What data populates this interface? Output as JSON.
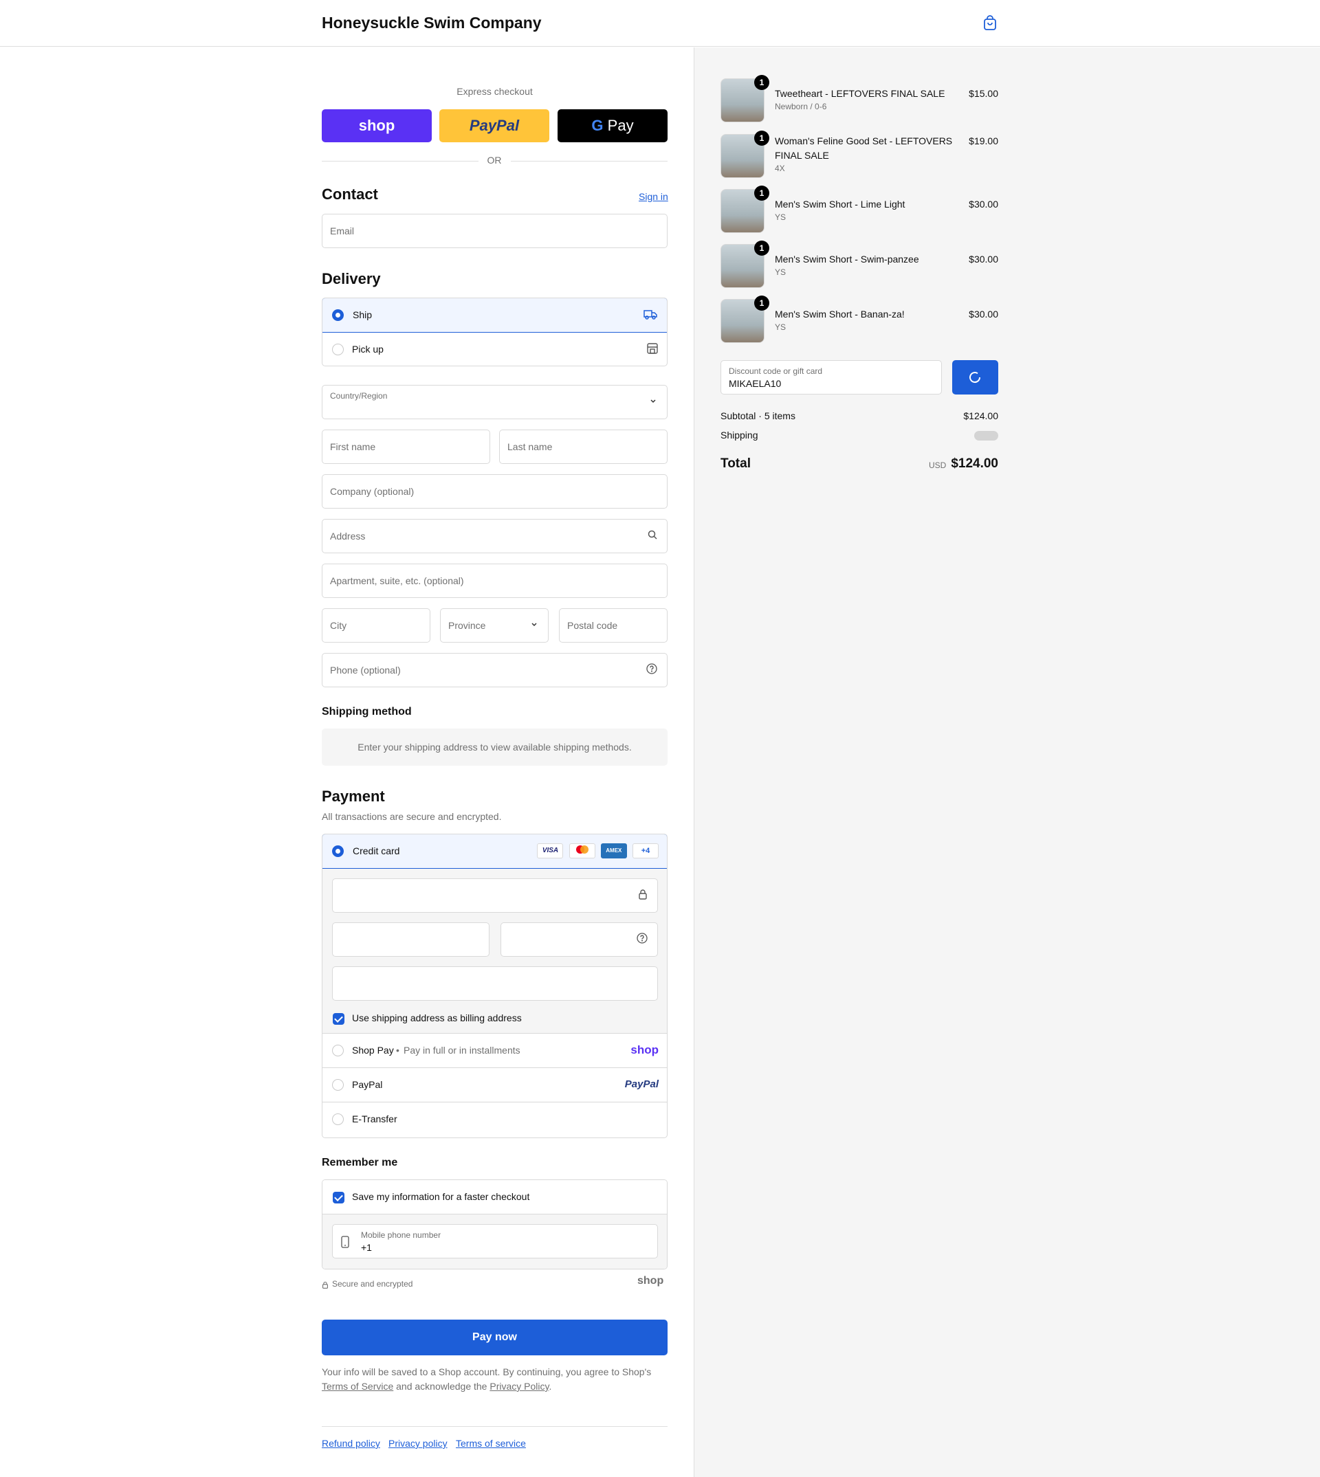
{
  "header": {
    "store_name": "Honeysuckle Swim Company"
  },
  "express": {
    "label": "Express checkout",
    "shop_label": "shop",
    "paypal_label": "PayPal",
    "gpay_label": "Pay",
    "or_label": "OR",
    "colors": {
      "shop": "#5a31f4",
      "paypal": "#ffc439",
      "gpay": "#000000"
    }
  },
  "contact": {
    "title": "Contact",
    "sign_in": "Sign in",
    "email_placeholder": "Email"
  },
  "delivery": {
    "title": "Delivery",
    "options": [
      {
        "label": "Ship",
        "selected": true,
        "icon": "truck-icon"
      },
      {
        "label": "Pick up",
        "selected": false,
        "icon": "store-icon"
      }
    ],
    "country_label": "Country/Region",
    "first_name": "First name",
    "last_name": "Last name",
    "company": "Company (optional)",
    "address": "Address",
    "apartment": "Apartment, suite, etc. (optional)",
    "city": "City",
    "province": "Province",
    "postal": "Postal code",
    "phone": "Phone (optional)"
  },
  "shipping_method": {
    "title": "Shipping method",
    "message": "Enter your shipping address to view available shipping methods."
  },
  "payment": {
    "title": "Payment",
    "subtitle": "All transactions are secure and encrypted.",
    "credit_card_label": "Credit card",
    "card_brands": [
      "VISA",
      "mastercard",
      "AMEX"
    ],
    "more_brands": "+4",
    "billing_same": "Use shipping address as billing address",
    "shop_pay_label": "Shop Pay",
    "shop_pay_sub": "Pay in full or in installments",
    "shop_pay_logo": "shop",
    "paypal_label": "PayPal",
    "paypal_logo": "PayPal",
    "etransfer_label": "E-Transfer"
  },
  "remember": {
    "title": "Remember me",
    "save_label": "Save my information for a faster checkout",
    "phone_label": "Mobile phone number",
    "phone_value": "+1",
    "secure_label": "Secure and encrypted",
    "shop_logo": "shop"
  },
  "pay_now": "Pay now",
  "legal": {
    "text_before": "Your info will be saved to a Shop account. By continuing, you agree to Shop's",
    "terms": "Terms of Service",
    "middle": "and acknowledge the",
    "privacy": "Privacy Policy",
    "end": "."
  },
  "footer_links": [
    "Refund policy",
    "Privacy policy",
    "Terms of service"
  ],
  "order": {
    "items": [
      {
        "name": "Tweetheart - LEFTOVERS FINAL SALE",
        "variant": "Newborn / 0-6",
        "price": "$15.00",
        "qty": "1"
      },
      {
        "name": "Woman's Feline Good Set - LEFTOVERS FINAL SALE",
        "variant": "4X",
        "price": "$19.00",
        "qty": "1"
      },
      {
        "name": "Men's Swim Short - Lime Light",
        "variant": "YS",
        "price": "$30.00",
        "qty": "1"
      },
      {
        "name": "Men's Swim Short - Swim-panzee",
        "variant": "YS",
        "price": "$30.00",
        "qty": "1"
      },
      {
        "name": "Men's Swim Short - Banan-za!",
        "variant": "YS",
        "price": "$30.00",
        "qty": "1"
      }
    ],
    "discount_label": "Discount code or gift card",
    "discount_value": "MIKAELA10",
    "subtotal_label": "Subtotal · 5 items",
    "subtotal_value": "$124.00",
    "shipping_label": "Shipping",
    "total_label": "Total",
    "currency": "USD",
    "total_value": "$124.00"
  },
  "accent_color": "#1d5ed8"
}
